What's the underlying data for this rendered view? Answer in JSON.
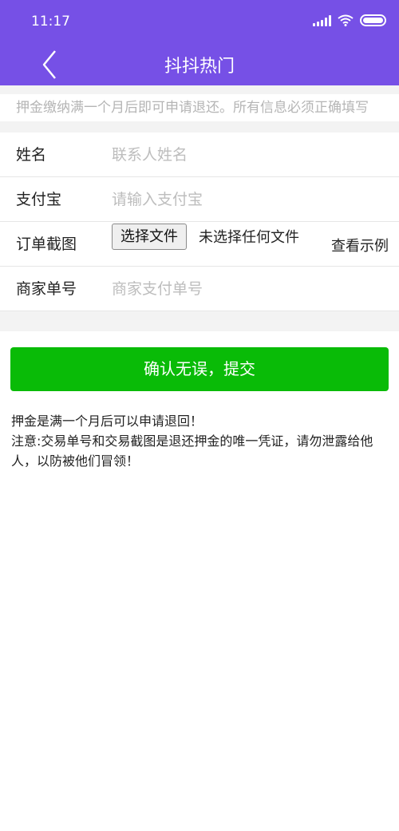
{
  "status_bar": {
    "time": "11:17"
  },
  "header": {
    "title": "抖抖热门"
  },
  "notice": {
    "text": "押金缴纳满一个月后即可申请退还。所有信息必须正确填写"
  },
  "form": {
    "name": {
      "label": "姓名",
      "placeholder": "联系人姓名"
    },
    "alipay": {
      "label": "支付宝",
      "placeholder": "请输入支付宝"
    },
    "order_screenshot": {
      "label": "订单截图",
      "button_label": "选择文件",
      "file_status": "未选择任何文件",
      "example_link": "查看示例"
    },
    "merchant_order": {
      "label": "商家单号",
      "placeholder": "商家支付单号"
    }
  },
  "submit": {
    "label": "确认无误，提交"
  },
  "notes": {
    "line1": "押金是满一个月后可以申请退回！",
    "line2": "注意:交易单号和交易截图是退还押金的唯一凭证，请勿泄露给他人，以防被他们冒领！"
  },
  "colors": {
    "header_bg": "#7650e6",
    "submit_bg": "#09bb07"
  },
  "icons": [
    "wifi-icon",
    "signal-icon",
    "battery-icon",
    "back-arrow-icon"
  ]
}
